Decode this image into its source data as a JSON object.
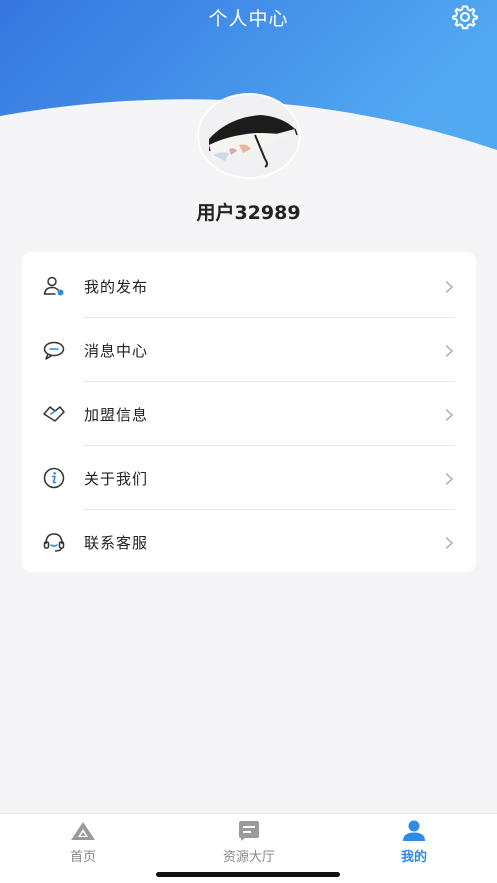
{
  "header": {
    "title": "个人中心",
    "settings_icon": "gear-icon",
    "gradient_colors": [
      "#3a7ee2",
      "#4aa3f0"
    ]
  },
  "profile": {
    "avatar_icon": "umbrella-avatar",
    "username": "用户32989"
  },
  "menu": {
    "items": [
      {
        "label": "我的发布",
        "icon": "user-publish-icon"
      },
      {
        "label": "消息中心",
        "icon": "message-icon"
      },
      {
        "label": "加盟信息",
        "icon": "handshake-icon"
      },
      {
        "label": "关于我们",
        "icon": "info-icon"
      },
      {
        "label": "联系客服",
        "icon": "headset-icon"
      }
    ]
  },
  "tabbar": {
    "tabs": [
      {
        "label": "首页",
        "icon": "home-icon",
        "active": false
      },
      {
        "label": "资源大厅",
        "icon": "resource-hall-icon",
        "active": false
      },
      {
        "label": "我的",
        "icon": "profile-icon",
        "active": true
      }
    ],
    "active_color": "#2f8ae8",
    "inactive_color": "#888888"
  }
}
